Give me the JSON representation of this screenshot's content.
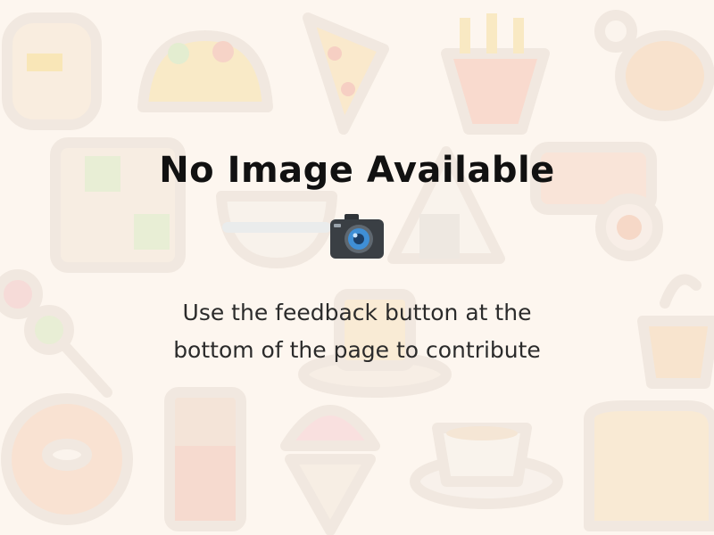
{
  "placeholder": {
    "headline": "No Image Available",
    "message_line1": "Use the feedback button at the",
    "message_line2": "bottom of the page to contribute",
    "icon": "camera-icon"
  },
  "colors": {
    "background": "#fdf6ef",
    "pattern_outline": "#ece3da",
    "text": "#111111",
    "camera_body": "#3a3f44",
    "camera_lens": "#3f8fd6"
  },
  "background_icons": [
    "pancakes-icon",
    "taco-icon",
    "pizza-slice-icon",
    "fries-icon",
    "chicken-leg-icon",
    "bento-box-icon",
    "noodle-bowl-icon",
    "rice-ball-icon",
    "sushi-icon",
    "dango-icon",
    "dessert-plate-icon",
    "pie-icon",
    "donut-icon",
    "chocolate-bar-icon",
    "shaved-ice-icon",
    "coffee-cup-icon",
    "bread-icon"
  ]
}
